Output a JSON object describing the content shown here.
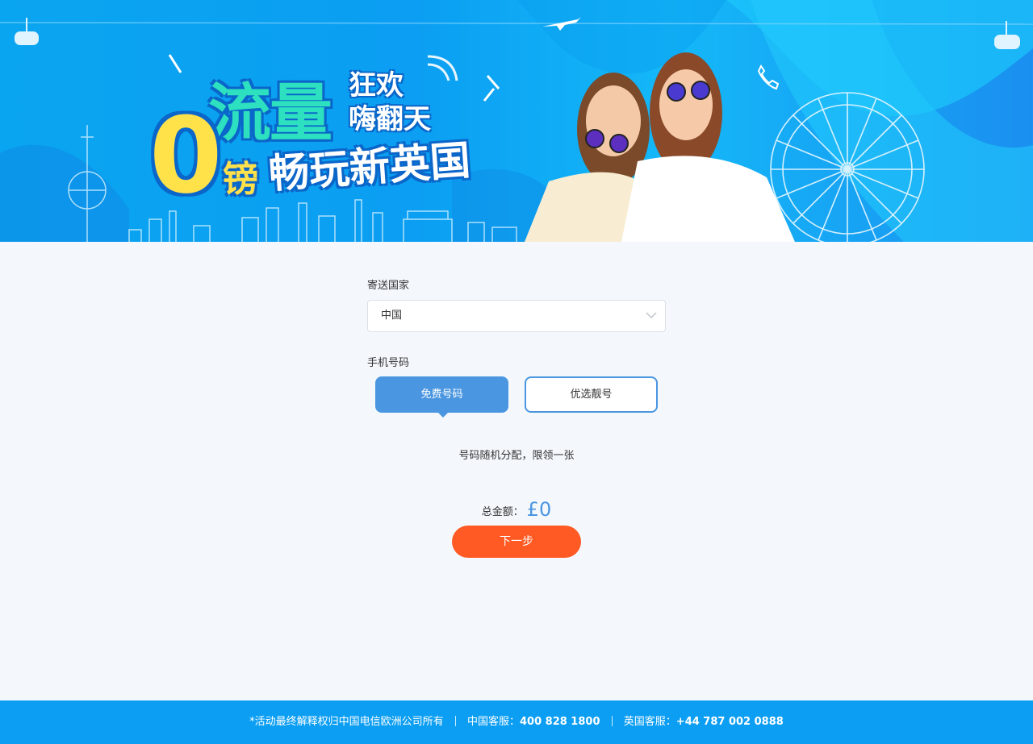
{
  "banner": {
    "headline_big": "流量",
    "headline_small_1": "狂欢",
    "headline_small_2": "嗨翻天",
    "headline_zero": "0",
    "headline_bang": "镑",
    "headline_rest": "畅玩新英国"
  },
  "form": {
    "country_label": "寄送国家",
    "country_value": "中国",
    "phone_label": "手机号码",
    "option_free": "免费号码",
    "option_pick": "优选靓号",
    "hint": "号码随机分配，限领一张",
    "total_label": "总金额：",
    "total_amount": "£0",
    "next_button": "下一步"
  },
  "footer": {
    "disclaimer": "*活动最终解释权归中国电信欧洲公司所有",
    "china_service_label": "中国客服：",
    "china_service_number": "400 828 1800",
    "uk_service_label": "英国客服：",
    "uk_service_number": "+44 787 002 0888"
  }
}
